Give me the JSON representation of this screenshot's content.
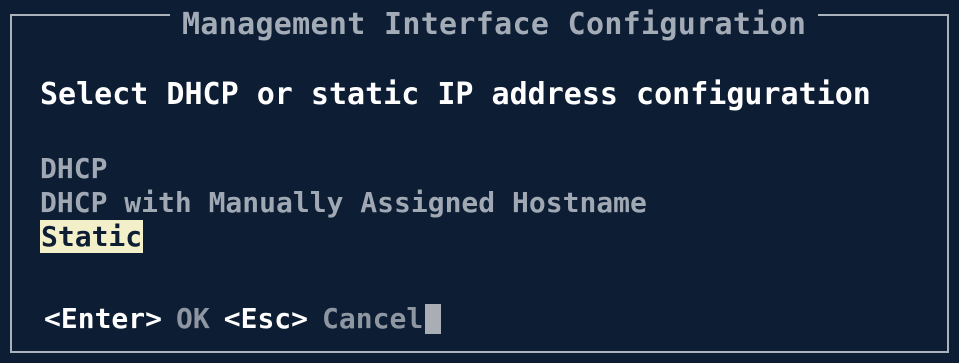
{
  "dialog": {
    "title": "Management Interface Configuration",
    "prompt": "Select DHCP or static IP address configuration",
    "options": [
      {
        "label": "DHCP",
        "selected": false
      },
      {
        "label": "DHCP with Manually Assigned Hostname",
        "selected": false
      },
      {
        "label": "Static",
        "selected": true
      }
    ],
    "actions": {
      "enter_key": "<Enter>",
      "enter_label": "OK",
      "esc_key": "<Esc>",
      "esc_label": "Cancel"
    }
  },
  "colors": {
    "background": "#0c1d34",
    "highlight": "#f2efc9",
    "text_bright": "#ffffff",
    "text_dim": "#a0a8b3"
  }
}
